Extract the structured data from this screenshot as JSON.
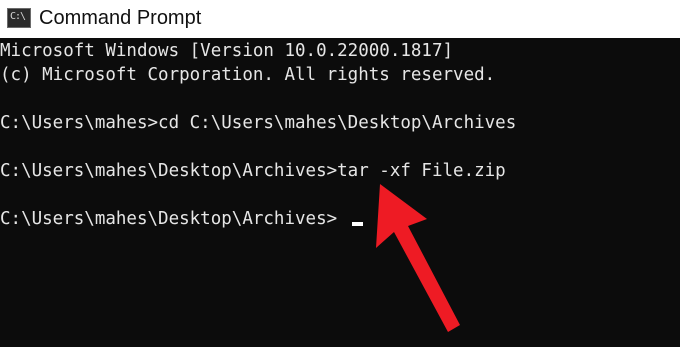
{
  "window": {
    "title": "Command Prompt",
    "icon": "command-prompt-icon",
    "icon_glyph": "C:\\"
  },
  "console": {
    "lines": [
      "Microsoft Windows [Version 10.0.22000.1817]",
      "(c) Microsoft Corporation. All rights reserved.",
      "C:\\Users\\mahes>cd C:\\Users\\mahes\\Desktop\\Archives",
      "C:\\Users\\mahes\\Desktop\\Archives>tar -xf File.zip",
      "C:\\Users\\mahes\\Desktop\\Archives>"
    ]
  },
  "annotation": {
    "type": "arrow",
    "color": "#ee1b24"
  }
}
